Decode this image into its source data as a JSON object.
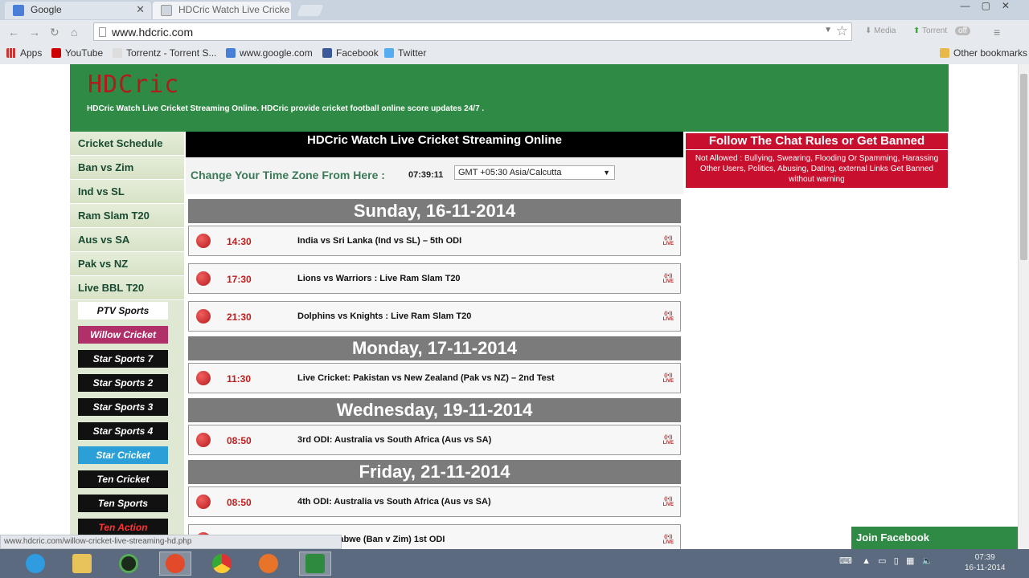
{
  "browser": {
    "tabs": [
      {
        "label": "Google",
        "active": false
      },
      {
        "label": "HDCric Watch Live Cricke",
        "active": true
      }
    ],
    "url": "www.hdcric.com",
    "extensions": [
      "Media",
      "Torrent",
      "off"
    ],
    "bookmarks": [
      "Apps",
      "YouTube",
      "Torrentz - Torrent S...",
      "www.google.com",
      "Facebook",
      "Twitter"
    ],
    "other_bookmarks": "Other bookmarks",
    "status_url": "www.hdcric.com/willow-cricket-live-streaming-hd.php"
  },
  "site": {
    "logo": "HDCric",
    "tagline": "HDCric Watch Live Cricket Streaming Online. HDCric provide cricket football online score updates 24/7 ."
  },
  "sidebar": {
    "items": [
      "Cricket Schedule",
      "Ban vs Zim",
      "Ind vs SL",
      "Ram Slam T20",
      "Aus vs SA",
      "Pak vs NZ",
      "Live BBL T20"
    ],
    "channels": [
      {
        "name": "PTV Sports",
        "color": "#ffffff",
        "text_color": "#111111"
      },
      {
        "name": "Willow Cricket",
        "color": "#b0306a",
        "text_color": "#ffffff"
      },
      {
        "name": "Star Sports 7",
        "color": "#111111",
        "text_color": "#ffffff"
      },
      {
        "name": "Star Sports 2",
        "color": "#111111",
        "text_color": "#ffffff"
      },
      {
        "name": "Star Sports 3",
        "color": "#111111",
        "text_color": "#ffffff"
      },
      {
        "name": "Star Sports 4",
        "color": "#111111",
        "text_color": "#ffffff"
      },
      {
        "name": "Star Cricket",
        "color": "#2a9fd8",
        "text_color": "#ffffff"
      },
      {
        "name": "Ten Cricket",
        "color": "#111111",
        "text_color": "#ffffff"
      },
      {
        "name": "Ten Sports",
        "color": "#111111",
        "text_color": "#ffffff"
      },
      {
        "name": "Ten Action",
        "color": "#111111",
        "text_color": "#ff3333"
      }
    ]
  },
  "main": {
    "title": "HDCric Watch Live Cricket Streaming Online",
    "timezone_label": "Change Your Time Zone From Here :",
    "time": "07:39:11",
    "timezone_value": "GMT +05:30 Asia/Calcutta",
    "days": [
      {
        "label": "Sunday, 16-11-2014",
        "matches": [
          {
            "time": "14:30",
            "name": "India vs Sri Lanka (Ind vs SL) – 5th ODI"
          },
          {
            "time": "17:30",
            "name": "Lions vs Warriors : Live Ram Slam T20"
          },
          {
            "time": "21:30",
            "name": "Dolphins vs Knights : Live Ram Slam T20"
          }
        ]
      },
      {
        "label": "Monday, 17-11-2014",
        "matches": [
          {
            "time": "11:30",
            "name": "Live Cricket: Pakistan vs New Zealand (Pak vs NZ) – 2nd Test"
          }
        ]
      },
      {
        "label": "Wednesday, 19-11-2014",
        "matches": [
          {
            "time": "08:50",
            "name": "3rd ODI: Australia vs South Africa (Aus vs SA)"
          }
        ]
      },
      {
        "label": "Friday, 21-11-2014",
        "matches": [
          {
            "time": "08:50",
            "name": "4th ODI: Australia vs South Africa (Aus vs SA)"
          },
          {
            "time": "",
            "name": "h vs Zimbabwe (Ban v Zim) 1st ODI"
          }
        ]
      }
    ],
    "live_badge": "LIVE"
  },
  "rules": {
    "title": "Follow The Chat Rules or Get Banned",
    "text": "Not Allowed : Bullying, Swearing, Flooding Or Spamming, Harassing Other Users, Politics, Abusing, Dating, external Links Get Banned without warning"
  },
  "join_facebook": "Join Facebook",
  "taskbar": {
    "clock_time": "07:39",
    "clock_date": "16-11-2014"
  },
  "colors": {
    "header_green": "#2f8a45",
    "logo_red": "#b01c1c",
    "rules_red": "#c8102e",
    "day_grey": "#7b7b7b"
  }
}
